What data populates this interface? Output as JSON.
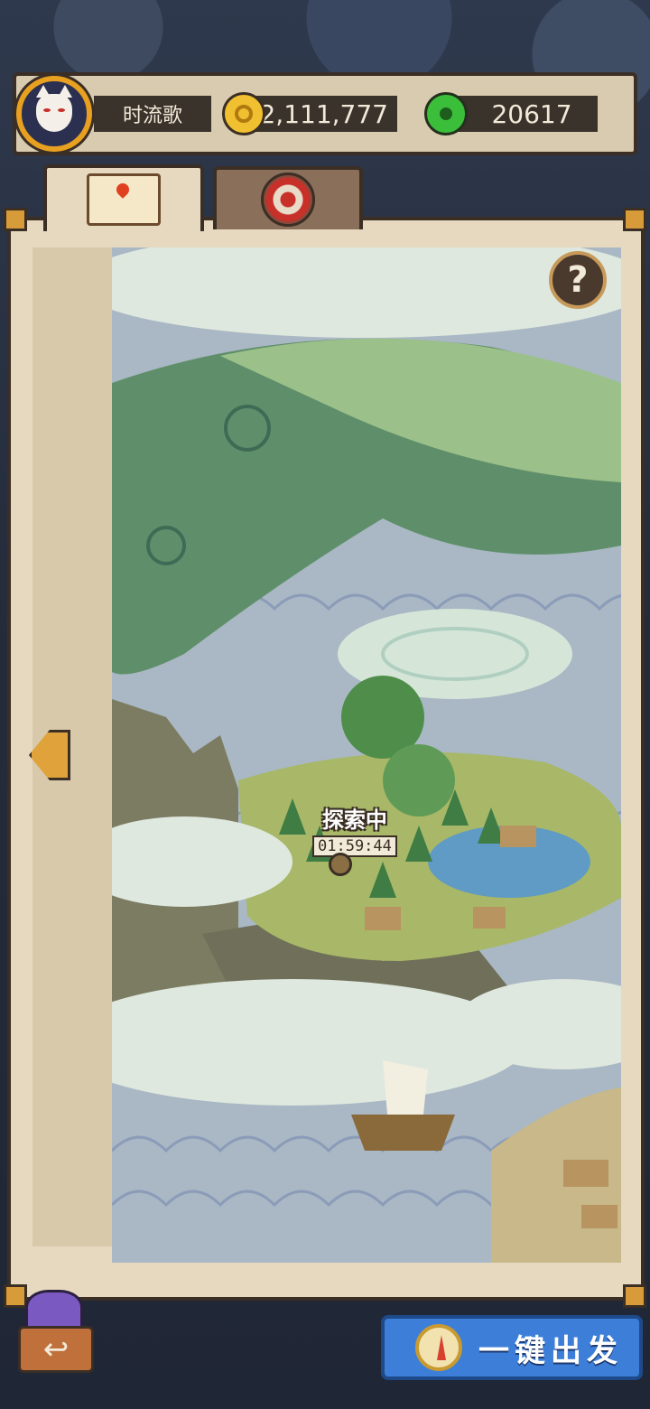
{
  "header": {
    "player_name": "时流歌",
    "coins": "12,111,777",
    "jade": "20617"
  },
  "tabs": [
    {
      "icon": "map-icon",
      "selected": true
    },
    {
      "icon": "target-icon",
      "selected": false
    }
  ],
  "map": {
    "help_label": "?",
    "status_title": "探索中",
    "status_timer": "01:59:44"
  },
  "footer": {
    "back_label": "↩",
    "go_label": "一键出发"
  },
  "colors": {
    "accent": "#3d7fd8",
    "panel": "#e6d9bf",
    "frame": "#3a2e25"
  }
}
